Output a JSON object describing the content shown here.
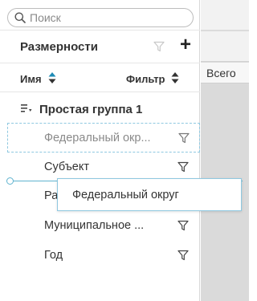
{
  "search": {
    "placeholder": "Поиск",
    "value": ""
  },
  "dimensions_panel": {
    "title": "Размерности",
    "add_label": "+",
    "columns": {
      "name": "Имя",
      "filter": "Фильтр"
    },
    "group": {
      "label": "Простая группа 1"
    },
    "items": [
      {
        "label": "Субъект"
      },
      {
        "label": "Ра"
      },
      {
        "label": "Муниципальное ..."
      },
      {
        "label": "Год"
      }
    ],
    "dragged_item": {
      "label": "Федеральный окр..."
    },
    "drag_tooltip": {
      "label": "Федеральный округ"
    }
  },
  "table": {
    "header_total": "Всего"
  },
  "colors": {
    "accent": "#5fb3cf",
    "sort_active": "#1f8cb6",
    "muted": "#8a8a8a"
  },
  "icons": [
    "search-icon",
    "filter-icon",
    "plus-icon",
    "sort-icon",
    "group-icon"
  ]
}
